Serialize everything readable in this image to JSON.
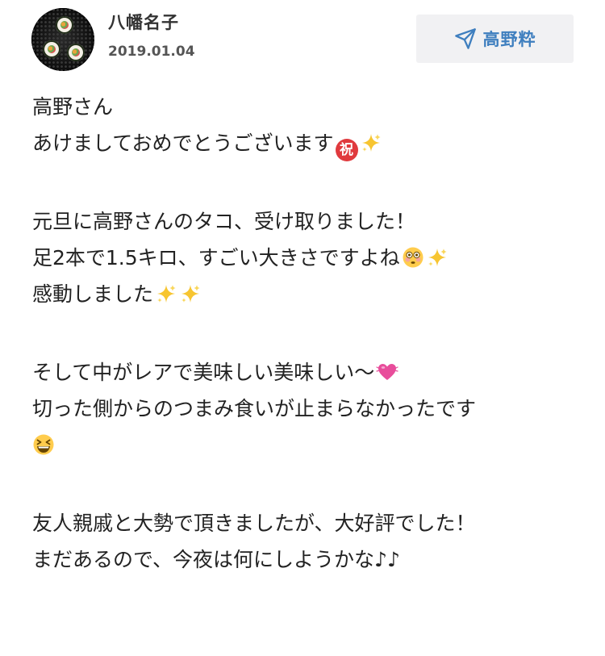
{
  "post": {
    "author_name": "八幡名子",
    "date": "2019.01.04",
    "send_button_label": "高野粋"
  },
  "body": {
    "greeting": "高野さん",
    "new_year": "あけましておめでとうございます",
    "iwai_char": "祝",
    "received": "元旦に高野さんのタコ、受け取りました！",
    "size_line": "足2本で1.5キロ、すごい大きさですよね",
    "moved": "感動しました",
    "rare_line": "そして中がレアで美味しい美味しい〜",
    "snack_line": "切った側からのつまみ食いが止まらなかったです",
    "shared_line": "友人親戚と大勢で頂きましたが、大好評でした！",
    "tonight_line": "まだあるので、今夜は何にしようかな♪♪"
  },
  "colors": {
    "accent": "#3f7fbf",
    "text": "#222222",
    "button_bg": "#f1f1f3",
    "iwai_red": "#e03a3e",
    "sparkle_yellow": "#f7c531",
    "heart_pink": "#e84d9b"
  },
  "icons": {
    "send": "paper-plane-icon",
    "emoji_iwai": "congratulations-emoji",
    "emoji_sparkles": "sparkles-emoji",
    "emoji_flushed": "flushed-face-emoji",
    "emoji_heart": "beating-heart-emoji",
    "emoji_laugh": "grinning-squinting-face-emoji"
  }
}
